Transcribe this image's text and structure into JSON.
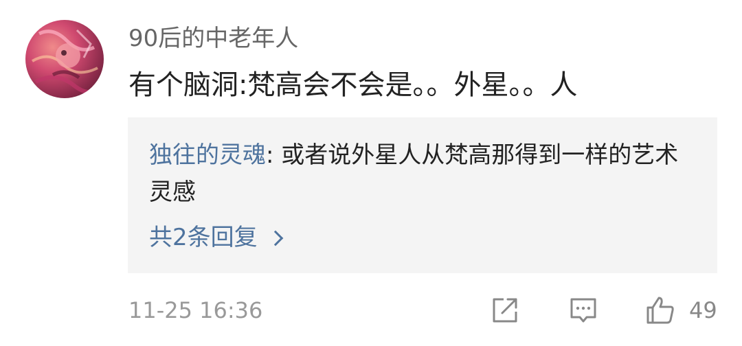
{
  "comment": {
    "username": "90后的中老年人",
    "text": "有个脑洞:梵高会不会是。。外星。。人",
    "avatar_icon": "avatar-image"
  },
  "reply": {
    "author": "独往的灵魂",
    "separator": ": ",
    "text": "或者说外星人从梵高那得到一样的艺术灵感"
  },
  "more_replies": {
    "label": "共2条回复",
    "icon": "chevron-right-icon"
  },
  "footer": {
    "timestamp": "11-25 16:36",
    "share_icon": "share-icon",
    "reply_icon": "comment-icon",
    "like_icon": "thumbs-up-icon",
    "like_count": "49"
  },
  "colors": {
    "link": "#4e739e",
    "text": "#222222",
    "muted": "#999999",
    "reply_bg": "#f4f4f4"
  }
}
